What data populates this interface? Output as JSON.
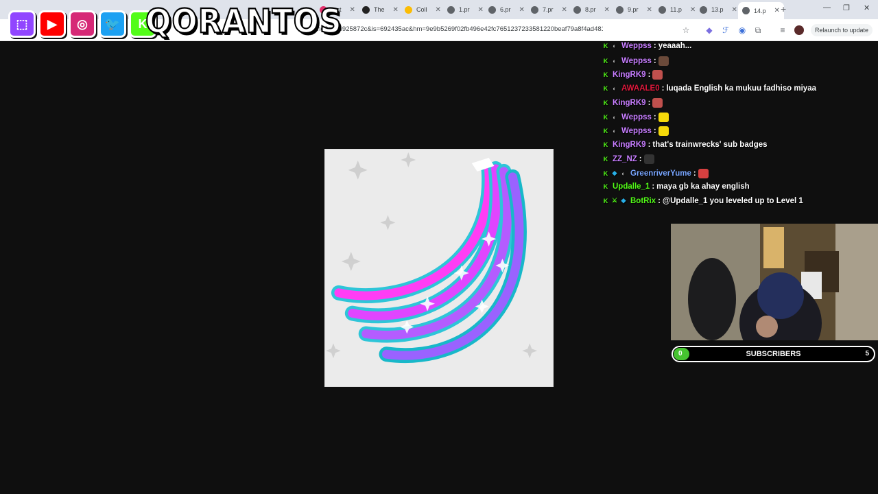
{
  "browser": {
    "tabs": [
      {
        "label": "Inst",
        "color": "#e1306c"
      },
      {
        "label": "The",
        "color": "#222222"
      },
      {
        "label": "Coll",
        "color": "#fbbc04"
      },
      {
        "label": "1.pr",
        "color": "#5f6368"
      },
      {
        "label": "6.pr",
        "color": "#5f6368"
      },
      {
        "label": "7.pr",
        "color": "#5f6368"
      },
      {
        "label": "8.pr",
        "color": "#5f6368"
      },
      {
        "label": "9.pr",
        "color": "#5f6368"
      },
      {
        "label": "11.p",
        "color": "#5f6368"
      },
      {
        "label": "13.p",
        "color": "#5f6368"
      },
      {
        "label": "14.p",
        "color": "#5f6368"
      }
    ],
    "new_tab": "+",
    "window_controls": {
      "minimize": "—",
      "restore": "❐",
      "close": "✕"
    },
    "url": "4.png?ex=6925872c&is=692435ac&hm=9e9b5269f02fb496e42fc7651237233581220beaf79a8f4ad4813a",
    "relaunch_label": "Relaunch to update",
    "icons": [
      "profile-icon",
      "bookmark-star-icon",
      "extension-icon",
      "translate-icon",
      "audio-icon",
      "puzzle-icon",
      "menu-icon",
      "avatar-icon"
    ]
  },
  "overlay": {
    "brand": "QORANTOS",
    "social_icons": [
      {
        "name": "twitch-icon",
        "glyph": "⬚",
        "color": "#9146ff"
      },
      {
        "name": "youtube-icon",
        "glyph": "▶",
        "color": "#ff0000"
      },
      {
        "name": "instagram-icon",
        "glyph": "◎",
        "color": "#d62976"
      },
      {
        "name": "twitter-icon",
        "glyph": "🐦",
        "color": "#1da1f2"
      },
      {
        "name": "kick-icon",
        "glyph": "K",
        "color": "#53fc18"
      }
    ]
  },
  "chat": {
    "messages": [
      {
        "badges": [
          "kick",
          "gift"
        ],
        "name": "Weppss",
        "name_color": "#c77dff",
        "text": "yeaaah..."
      },
      {
        "badges": [
          "kick",
          "gift"
        ],
        "name": "Weppss",
        "name_color": "#c77dff",
        "text": "",
        "emote": "#6b4a3a"
      },
      {
        "badges": [
          "kick"
        ],
        "name": "KingRK9",
        "name_color": "#c77dff",
        "text": "",
        "emote": "#c0504d"
      },
      {
        "badges": [
          "kick",
          "gift"
        ],
        "name": "AWAALE0",
        "name_color": "#e0193c",
        "text": "luqada English ka mukuu fadhiso miyaa"
      },
      {
        "badges": [
          "kick"
        ],
        "name": "KingRK9",
        "name_color": "#c77dff",
        "text": "",
        "emote": "#c0504d"
      },
      {
        "badges": [
          "kick",
          "gift"
        ],
        "name": "Weppss",
        "name_color": "#c77dff",
        "text": "",
        "emote": "#f5d90a"
      },
      {
        "badges": [
          "kick",
          "gift"
        ],
        "name": "Weppss",
        "name_color": "#c77dff",
        "text": "",
        "emote": "#f5d90a"
      },
      {
        "badges": [
          "kick"
        ],
        "name": "KingRK9",
        "name_color": "#c77dff",
        "text": "that's trainwrecks' sub badges"
      },
      {
        "badges": [
          "kick"
        ],
        "name": "ZZ_NZ",
        "name_color": "#c77dff",
        "text": "",
        "emote": "#333333"
      },
      {
        "badges": [
          "kick",
          "dia",
          "gift"
        ],
        "name": "GreenriverYume",
        "name_color": "#79a6ff",
        "text": "",
        "emote": "#d64040"
      },
      {
        "badges": [
          "kick"
        ],
        "name": "Updalle_1",
        "name_color": "#53fc18",
        "text": "maya gb ka ahay english"
      },
      {
        "badges": [
          "kick",
          "mod",
          "dia"
        ],
        "name": "BotRix",
        "name_color": "#53fc18",
        "text": "@Updalle_1 you leveled up to Level 1"
      }
    ]
  },
  "subs": {
    "label": "SUBSCRIBERS",
    "min": "0",
    "max": "5",
    "progress_fraction": 0.08,
    "fill_color": "#46c430"
  }
}
